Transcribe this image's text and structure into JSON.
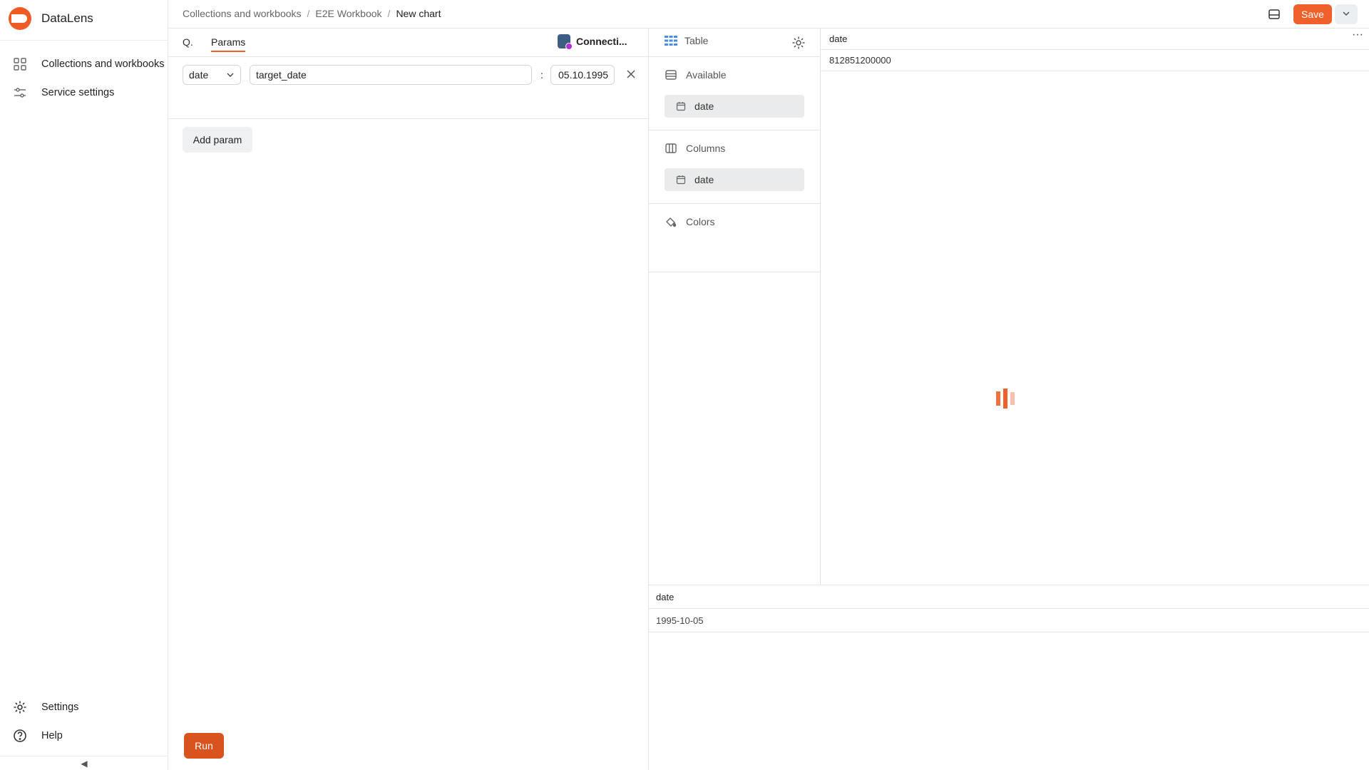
{
  "app": {
    "name": "DataLens"
  },
  "sidebar": {
    "items": [
      {
        "label": "Collections and workbooks",
        "icon": "grid-icon"
      },
      {
        "label": "Service settings",
        "icon": "sliders-icon"
      }
    ],
    "bottom": [
      {
        "label": "Settings",
        "icon": "gear-icon"
      },
      {
        "label": "Help",
        "icon": "help-icon"
      }
    ],
    "collapse_glyph": "◀"
  },
  "breadcrumbs": {
    "items": [
      "Collections and workbooks",
      "E2E Workbook"
    ],
    "current": "New chart",
    "separator": "/"
  },
  "header": {
    "save_label": "Save"
  },
  "query_panel": {
    "tabs": {
      "query": "Q.",
      "params": "Params"
    },
    "connection_label": "Connecti...",
    "param": {
      "type": "date",
      "name": "target_date",
      "separator": ":",
      "value": "05.10.1995"
    },
    "add_param_label": "Add param",
    "run_label": "Run"
  },
  "config_panel": {
    "visualization": "Table",
    "sections": [
      {
        "title": "Available",
        "items": [
          "date"
        ]
      },
      {
        "title": "Columns",
        "items": [
          "date"
        ]
      },
      {
        "title": "Colors",
        "items": []
      }
    ]
  },
  "preview": {
    "header": "date",
    "rows": [
      "812851200000"
    ],
    "more_glyph": "···"
  },
  "result_table": {
    "header": "date",
    "rows": [
      "1995-10-05"
    ]
  },
  "colors": {
    "accent": "#f0602a",
    "run": "#d9531e"
  }
}
